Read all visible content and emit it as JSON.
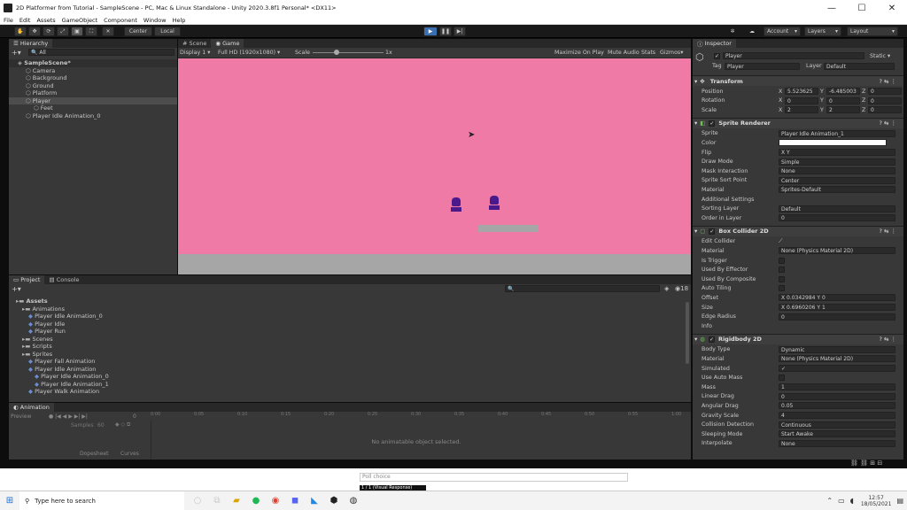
{
  "window": {
    "title": "2D Platformer from Tutorial - SampleScene - PC, Mac & Linux Standalone - Unity 2020.3.8f1 Personal* <DX11>"
  },
  "menu": [
    "File",
    "Edit",
    "Assets",
    "GameObject",
    "Component",
    "Window",
    "Help"
  ],
  "toolbar": {
    "pivot": "Center",
    "space": "Local",
    "account": "Account",
    "layers": "Layers",
    "layout": "Layout"
  },
  "hierarchy": {
    "tab": "Hierarchy",
    "search_placeholder": "All",
    "items": [
      {
        "label": "SampleScene*",
        "depth": 0
      },
      {
        "label": "Camera",
        "depth": 1
      },
      {
        "label": "Background",
        "depth": 1
      },
      {
        "label": "Ground",
        "depth": 1
      },
      {
        "label": "Platform",
        "depth": 1
      },
      {
        "label": "Player",
        "depth": 1
      },
      {
        "label": "Feet",
        "depth": 2
      },
      {
        "label": "Player Idle Animation_0",
        "depth": 1
      }
    ]
  },
  "scene_tabs": {
    "scene": "Scene",
    "game": "Game"
  },
  "game_bar": {
    "display": "Display 1",
    "resolution": "Full HD (1920x1080)",
    "scale_label": "Scale",
    "scale_value": "1x",
    "maximize": "Maximize On Play",
    "mute": "Mute Audio",
    "stats": "Stats",
    "gizmos": "Gizmos"
  },
  "game": {
    "bg": "#f07aa6",
    "ground": "#a6a6a6",
    "platform": "#a6a6a6",
    "player": "#4a1a8c"
  },
  "project": {
    "tab_project": "Project",
    "tab_console": "Console",
    "count": "18",
    "items": [
      {
        "label": "Assets",
        "depth": 0
      },
      {
        "label": "Animations",
        "depth": 1
      },
      {
        "label": "Player Idle Animation_0",
        "depth": 2
      },
      {
        "label": "Player Idle",
        "depth": 2
      },
      {
        "label": "Player Run",
        "depth": 2
      },
      {
        "label": "Scenes",
        "depth": 1
      },
      {
        "label": "Scripts",
        "depth": 1
      },
      {
        "label": "Sprites",
        "depth": 1
      },
      {
        "label": "Player Fall Animation",
        "depth": 2
      },
      {
        "label": "Player Idle Animation",
        "depth": 2
      },
      {
        "label": "Player Idle Animation_0",
        "depth": 3
      },
      {
        "label": "Player Idle Animation_1",
        "depth": 3
      },
      {
        "label": "Player Walk Animation",
        "depth": 2
      }
    ]
  },
  "animation": {
    "tab": "Animation",
    "preview": "Preview",
    "samples": "Samples",
    "samples_value": "60",
    "frame": "0",
    "empty": "No animatable object selected.",
    "dopesheet": "Dopesheet",
    "curves": "Curves",
    "ticks": [
      "0:00",
      "0:05",
      "0:10",
      "0:15",
      "0:20",
      "0:25",
      "0:30",
      "0:35",
      "0:40",
      "0:45",
      "0:50",
      "0:55",
      "1:00"
    ]
  },
  "inspector": {
    "tab": "Inspector",
    "name": "Player",
    "static": "Static",
    "tag_label": "Tag",
    "tag": "Player",
    "layer_label": "Layer",
    "layer": "Default",
    "transform": {
      "title": "Transform",
      "position": "Position",
      "rotation": "Rotation",
      "scale": "Scale",
      "pos": [
        "5.523625",
        "-6.485003",
        "0"
      ],
      "rot": [
        "0",
        "0",
        "0"
      ],
      "scl": [
        "2",
        "2",
        "0"
      ]
    },
    "sprite_renderer": {
      "title": "Sprite Renderer",
      "rows": [
        {
          "label": "Sprite",
          "value": "Player Idle Animation_1"
        },
        {
          "label": "Color",
          "value": ""
        },
        {
          "label": "Flip",
          "value": "X   Y"
        },
        {
          "label": "Draw Mode",
          "value": "Simple"
        },
        {
          "label": "Mask Interaction",
          "value": "None"
        },
        {
          "label": "Sprite Sort Point",
          "value": "Center"
        },
        {
          "label": "Material",
          "value": "Sprites-Default"
        },
        {
          "label": "Additional Settings",
          "value": ""
        },
        {
          "label": "Sorting Layer",
          "value": "Default"
        },
        {
          "label": "Order in Layer",
          "value": "0"
        }
      ]
    },
    "box_collider": {
      "title": "Box Collider 2D",
      "rows": [
        {
          "label": "Edit Collider",
          "value": ""
        },
        {
          "label": "Material",
          "value": "None (Physics Material 2D)"
        },
        {
          "label": "Is Trigger",
          "value": ""
        },
        {
          "label": "Used By Effector",
          "value": ""
        },
        {
          "label": "Used By Composite",
          "value": ""
        },
        {
          "label": "Auto Tiling",
          "value": ""
        },
        {
          "label": "Offset",
          "value": "X 0.0342984  Y 0"
        },
        {
          "label": "Size",
          "value": "X 0.6960206  Y 1"
        },
        {
          "label": "Edge Radius",
          "value": "0"
        },
        {
          "label": "Info",
          "value": ""
        }
      ]
    },
    "rigidbody": {
      "title": "Rigidbody 2D",
      "rows": [
        {
          "label": "Body Type",
          "value": "Dynamic"
        },
        {
          "label": "Material",
          "value": "None (Physics Material 2D)"
        },
        {
          "label": "Simulated",
          "value": "✓"
        },
        {
          "label": "Use Auto Mass",
          "value": ""
        },
        {
          "label": "Mass",
          "value": "1"
        },
        {
          "label": "Linear Drag",
          "value": "0"
        },
        {
          "label": "Angular Drag",
          "value": "0.05"
        },
        {
          "label": "Gravity Scale",
          "value": "4"
        },
        {
          "label": "Collision Detection",
          "value": "Continuous"
        },
        {
          "label": "Sleeping Mode",
          "value": "Start Awake"
        },
        {
          "label": "Interpolate",
          "value": "None"
        }
      ]
    }
  },
  "overlay": {
    "poll": "Poll choice",
    "tooltip": "1 / 1 (Visual Response)"
  },
  "taskbar": {
    "search": "Type here to search",
    "time": "12:57",
    "date": "18/05/2021"
  }
}
